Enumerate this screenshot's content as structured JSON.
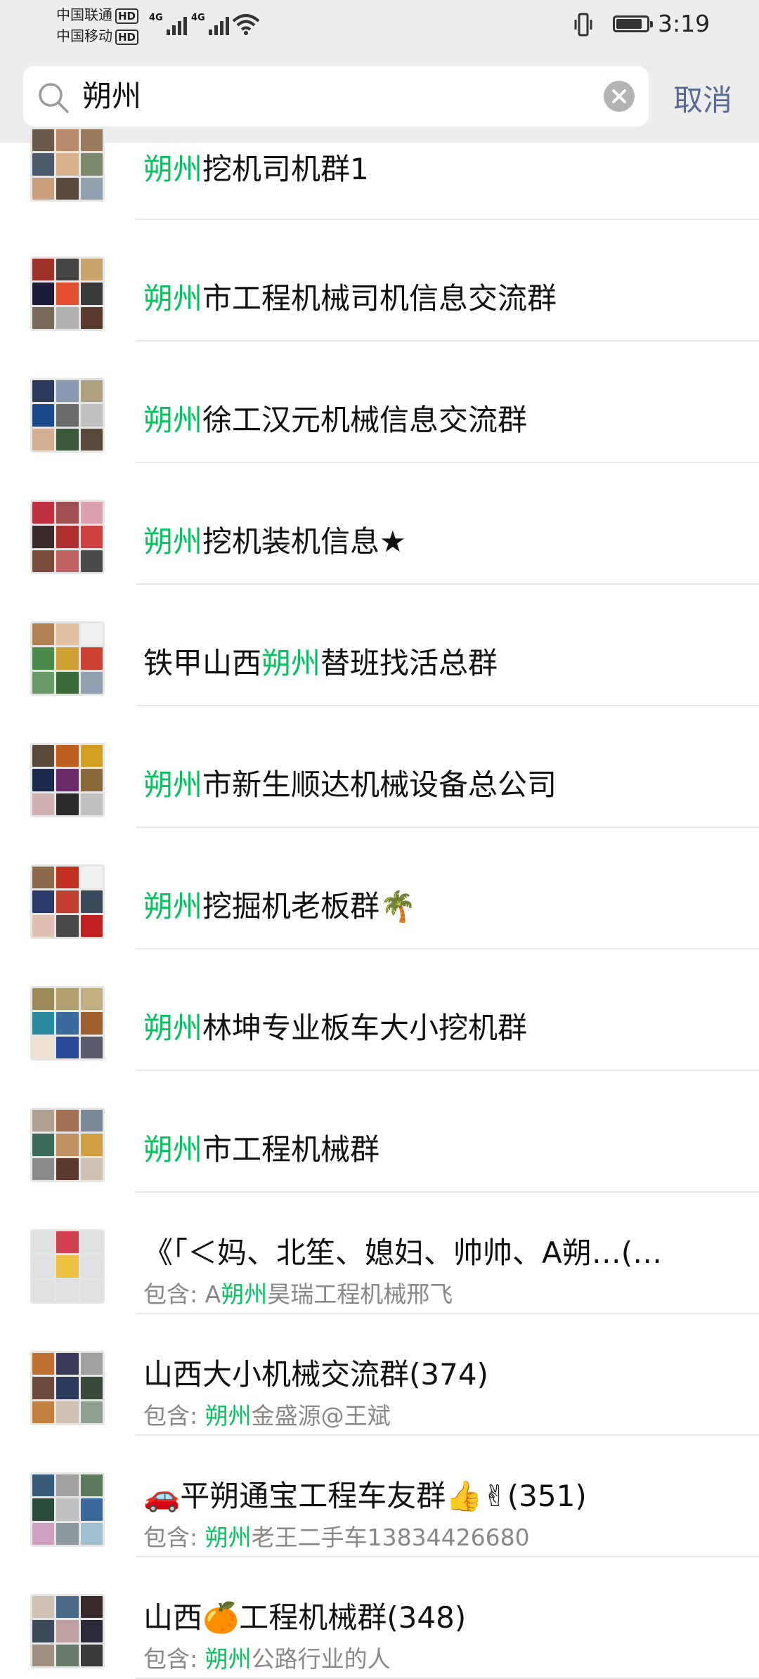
{
  "status_bar": {
    "carrier1": "中国联通",
    "carrier2": "中国移动",
    "hd": "HD",
    "net1": "4G",
    "net2": "4G",
    "battery_level": 0.85,
    "time": "3:19"
  },
  "search": {
    "query": "朔州",
    "cancel_label": "取消"
  },
  "results": [
    {
      "pre": "",
      "hl": "朔州",
      "post": "挖机司机群1"
    },
    {
      "pre": "",
      "hl": "朔州",
      "post": "市工程机械司机信息交流群"
    },
    {
      "pre": "",
      "hl": "朔州",
      "post": "徐工汉元机械信息交流群"
    },
    {
      "pre": "",
      "hl": "朔州",
      "post": "挖机装机信息★"
    },
    {
      "pre": "铁甲山西",
      "hl": "朔州",
      "post": "替班找活总群"
    },
    {
      "pre": "",
      "hl": "朔州",
      "post": "市新生顺达机械设备总公司"
    },
    {
      "pre": "",
      "hl": "朔州",
      "post": "挖掘机老板群🌴"
    },
    {
      "pre": "",
      "hl": "朔州",
      "post": "林坤专业板车大小挖机群"
    },
    {
      "pre": "",
      "hl": "朔州",
      "post": "市工程机械群"
    },
    {
      "title": "《「＜妈、北笙、媳妇、帅帅、A朔…(…",
      "sub_prefix": "包含: A",
      "sub_hl": "朔州",
      "sub_post": "昊瑞工程机械邢飞"
    },
    {
      "title": "山西大小机械交流群(374)",
      "sub_prefix": "包含: ",
      "sub_hl": "朔州",
      "sub_post": "金盛源@王斌"
    },
    {
      "title": "🚗平朔通宝工程车友群👍✌(351)",
      "sub_prefix": "包含: ",
      "sub_hl": "朔州",
      "sub_post": "老王二手车13834426680"
    },
    {
      "title": "山西🍊工程机械群(348)",
      "sub_prefix": "包含: ",
      "sub_hl": "朔州",
      "sub_post": "公路行业的人"
    }
  ]
}
